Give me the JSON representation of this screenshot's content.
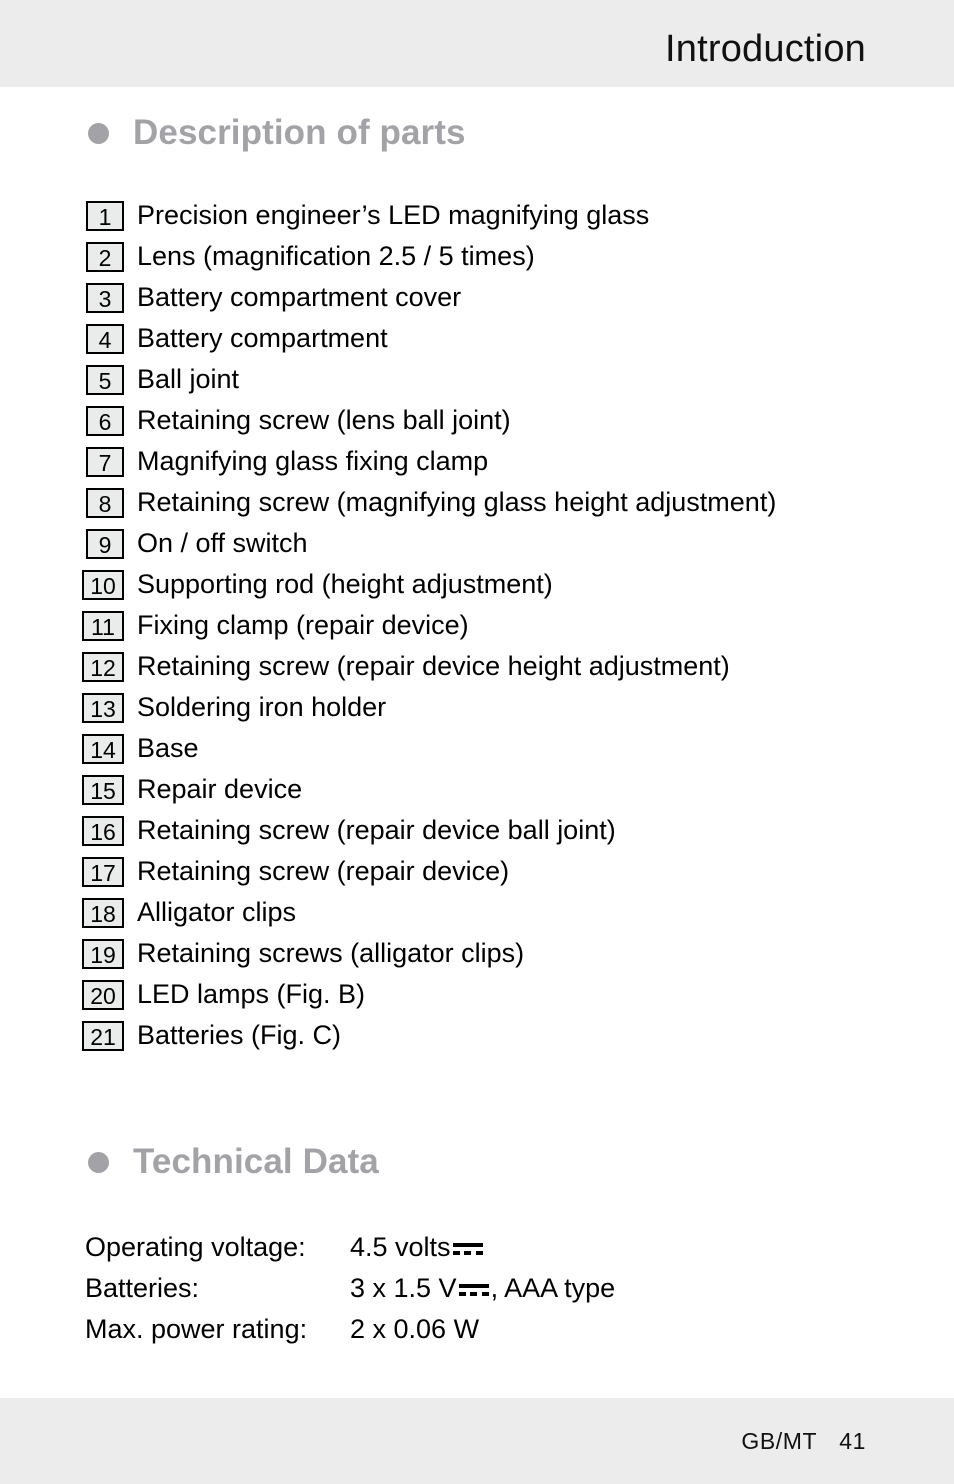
{
  "page": {
    "header_title": "Introduction",
    "footer_locale": "GB/MT",
    "footer_page_number": "41",
    "band_color": "#ececec",
    "heading_color": "#a2a2a7",
    "body_text_color": "#000000",
    "number_box_fill": "#eaeceb",
    "number_box_border": "#000000"
  },
  "sections": {
    "description": {
      "bullet_icon": "filled-circle-bullet",
      "heading": "Description of parts",
      "items": [
        {
          "number": "1",
          "label": "Precision engineer’s LED magnifying glass"
        },
        {
          "number": "2",
          "label": "Lens (magnification 2.5 / 5 times)"
        },
        {
          "number": "3",
          "label": "Battery compartment cover"
        },
        {
          "number": "4",
          "label": "Battery compartment"
        },
        {
          "number": "5",
          "label": "Ball joint"
        },
        {
          "number": "6",
          "label": "Retaining screw (lens ball joint)"
        },
        {
          "number": "7",
          "label": "Magnifying glass fixing clamp"
        },
        {
          "number": "8",
          "label": "Retaining screw (magnifying glass height adjustment)"
        },
        {
          "number": "9",
          "label": "On / off switch"
        },
        {
          "number": "10",
          "label": "Supporting rod (height adjustment)"
        },
        {
          "number": "11",
          "label": "Fixing clamp (repair device)"
        },
        {
          "number": "12",
          "label": "Retaining screw (repair device height adjustment)"
        },
        {
          "number": "13",
          "label": "Soldering iron holder"
        },
        {
          "number": "14",
          "label": "Base"
        },
        {
          "number": "15",
          "label": "Repair device"
        },
        {
          "number": "16",
          "label": "Retaining screw (repair device ball joint)"
        },
        {
          "number": "17",
          "label": "Retaining screw (repair device)"
        },
        {
          "number": "18",
          "label": "Alligator clips"
        },
        {
          "number": "19",
          "label": "Retaining screws (alligator clips)"
        },
        {
          "number": "20",
          "label": "LED lamps (Fig. B)"
        },
        {
          "number": "21",
          "label": "Batteries (Fig. C)"
        }
      ]
    },
    "technical": {
      "bullet_icon": "filled-circle-bullet",
      "heading": "Technical Data",
      "rows": [
        {
          "label": "Operating voltage:",
          "value_before": "4.5 volts",
          "dc_symbol": true,
          "dc_symbol_icon": "dc-current-icon",
          "value_after": ""
        },
        {
          "label": "Batteries:",
          "value_before": "3 x 1.5 V",
          "dc_symbol": true,
          "dc_symbol_icon": "dc-current-icon",
          "value_after": ", AAA type"
        },
        {
          "label": "Max. power rating:",
          "value_before": "2 x 0.06 W",
          "dc_symbol": false,
          "dc_symbol_icon": "",
          "value_after": ""
        }
      ]
    }
  }
}
